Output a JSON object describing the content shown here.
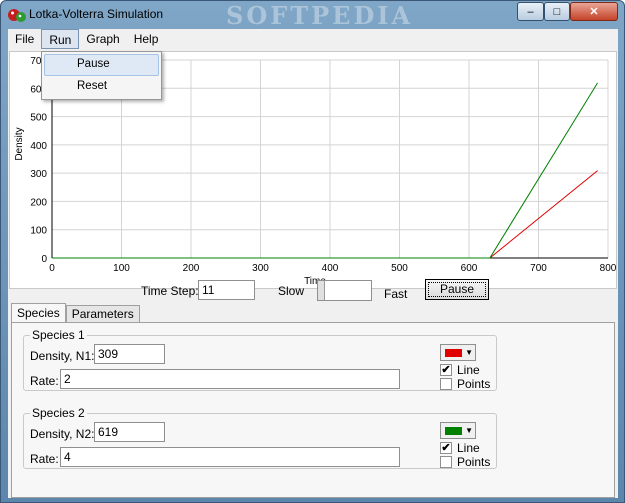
{
  "window": {
    "title": "Lotka-Volterra Simulation",
    "watermark": "SOFTPEDIA",
    "controls": {
      "minimize": "–",
      "maximize": "□",
      "close": "✕"
    }
  },
  "menubar": {
    "items": [
      "File",
      "Run",
      "Graph",
      "Help"
    ]
  },
  "run_menu": {
    "items": [
      "Pause",
      "Reset"
    ]
  },
  "chart_data": {
    "type": "line",
    "xlabel": "Time",
    "ylabel": "Density",
    "xlim": [
      0,
      800
    ],
    "ylim": [
      0,
      700
    ],
    "x_ticks": [
      0,
      100,
      200,
      300,
      400,
      500,
      600,
      700,
      800
    ],
    "y_ticks": [
      0,
      100,
      200,
      300,
      400,
      500,
      600,
      700
    ],
    "grid": true,
    "series": [
      {
        "color": "#e00000",
        "x": [
          0,
          630,
          785
        ],
        "y": [
          0,
          0,
          309
        ]
      },
      {
        "color": "#008000",
        "x": [
          0,
          630,
          785
        ],
        "y": [
          0,
          0,
          619
        ]
      }
    ]
  },
  "controls": {
    "time_step_label": "Time Step:",
    "time_step_value": "11",
    "slow_label": "Slow",
    "fast_label": "Fast",
    "pause_button": "Pause"
  },
  "tabs": [
    "Species",
    "Parameters"
  ],
  "species1": {
    "title": "Species 1",
    "density_label": "Density, N1:",
    "density_value": "309",
    "rate_label": "Rate:",
    "rate_value": "2",
    "color": "#e00000",
    "line_label": "Line",
    "points_label": "Points",
    "line_checked": "✔",
    "points_checked": ""
  },
  "species2": {
    "title": "Species 2",
    "density_label": "Density, N2:",
    "density_value": "619",
    "rate_label": "Rate:",
    "rate_value": "4",
    "color": "#008000",
    "line_label": "Line",
    "points_label": "Points",
    "line_checked": "✔",
    "points_checked": ""
  }
}
